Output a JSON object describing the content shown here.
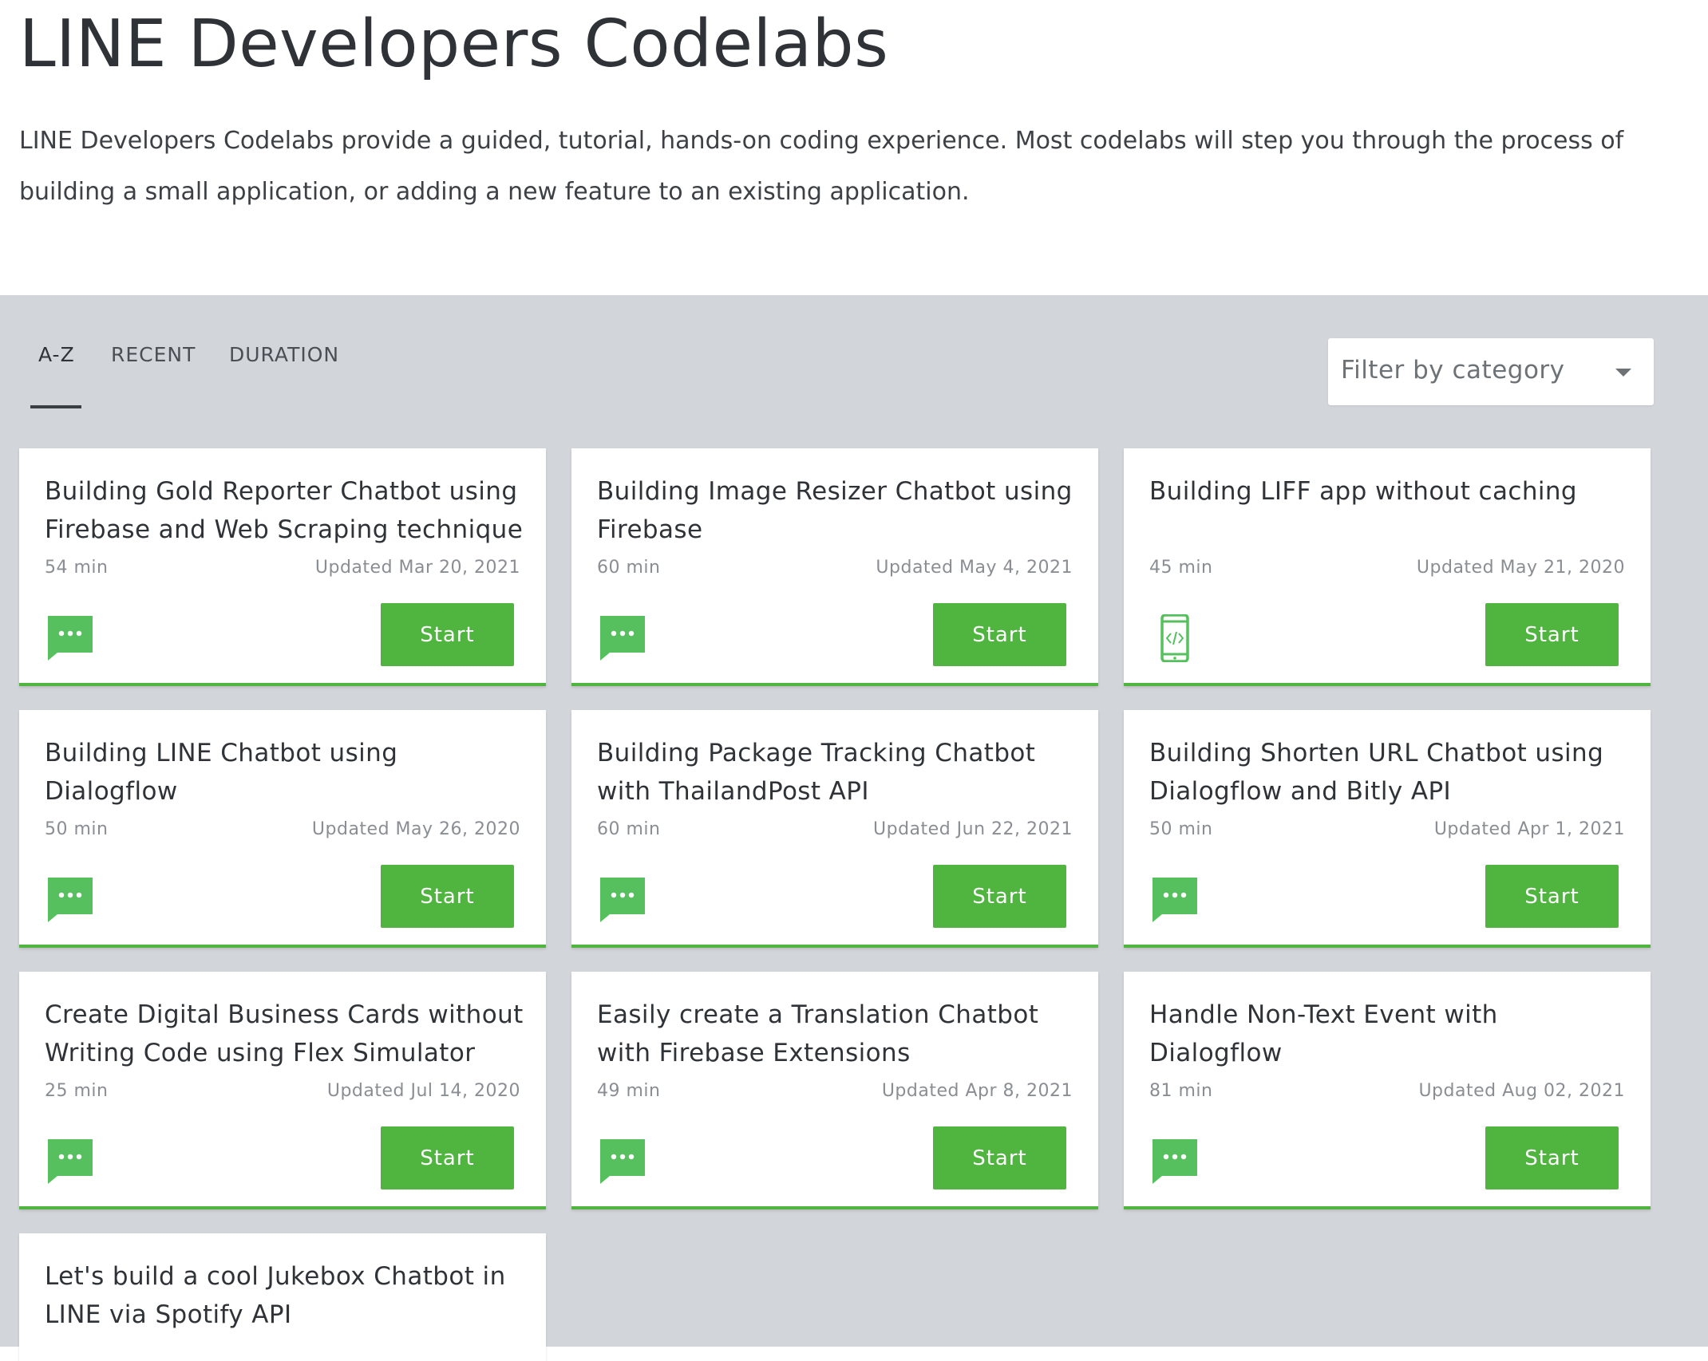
{
  "header": {
    "title": "LINE Developers Codelabs",
    "intro": "LINE Developers Codelabs provide a guided, tutorial, hands-on coding experience. Most codelabs will step you through the process of building a small application, or adding a new feature to an existing application."
  },
  "tabs": [
    "A-Z",
    "RECENT",
    "DURATION"
  ],
  "active_tab": "A-Z",
  "filter": {
    "label": "Filter by category"
  },
  "colors": {
    "accent": "#4fb53f",
    "background": "#d2d5da"
  },
  "cards": [
    {
      "title": "Building Gold Reporter Chatbot using Firebase and Web Scraping technique",
      "duration": "54 min",
      "updated": "Updated Mar 20, 2021",
      "icon": "chat-icon",
      "button": "Start"
    },
    {
      "title": "Building Image Resizer Chatbot using Firebase",
      "duration": "60 min",
      "updated": "Updated May 4, 2021",
      "icon": "chat-icon",
      "button": "Start"
    },
    {
      "title": "Building LIFF app without caching",
      "duration": "45 min",
      "updated": "Updated May 21, 2020",
      "icon": "mobile-code-icon",
      "button": "Start"
    },
    {
      "title": "Building LINE Chatbot using Dialogflow",
      "duration": "50 min",
      "updated": "Updated May 26, 2020",
      "icon": "chat-icon",
      "button": "Start"
    },
    {
      "title": "Building Package Tracking Chatbot with ThailandPost API",
      "duration": "60 min",
      "updated": "Updated Jun 22, 2021",
      "icon": "chat-icon",
      "button": "Start"
    },
    {
      "title": "Building Shorten URL Chatbot using Dialogflow and Bitly API",
      "duration": "50 min",
      "updated": "Updated Apr 1, 2021",
      "icon": "chat-icon",
      "button": "Start"
    },
    {
      "title": "Create Digital Business Cards without Writing Code using Flex Simulator",
      "duration": "25 min",
      "updated": "Updated Jul 14, 2020",
      "icon": "chat-icon",
      "button": "Start"
    },
    {
      "title": "Easily create a Translation Chatbot with Firebase Extensions",
      "duration": "49 min",
      "updated": "Updated Apr 8, 2021",
      "icon": "chat-icon",
      "button": "Start"
    },
    {
      "title": "Handle Non-Text Event with Dialogflow",
      "duration": "81 min",
      "updated": "Updated Aug 02, 2021",
      "icon": "chat-icon",
      "button": "Start"
    },
    {
      "title": "Let's build a cool Jukebox Chatbot in LINE via Spotify API"
    }
  ]
}
